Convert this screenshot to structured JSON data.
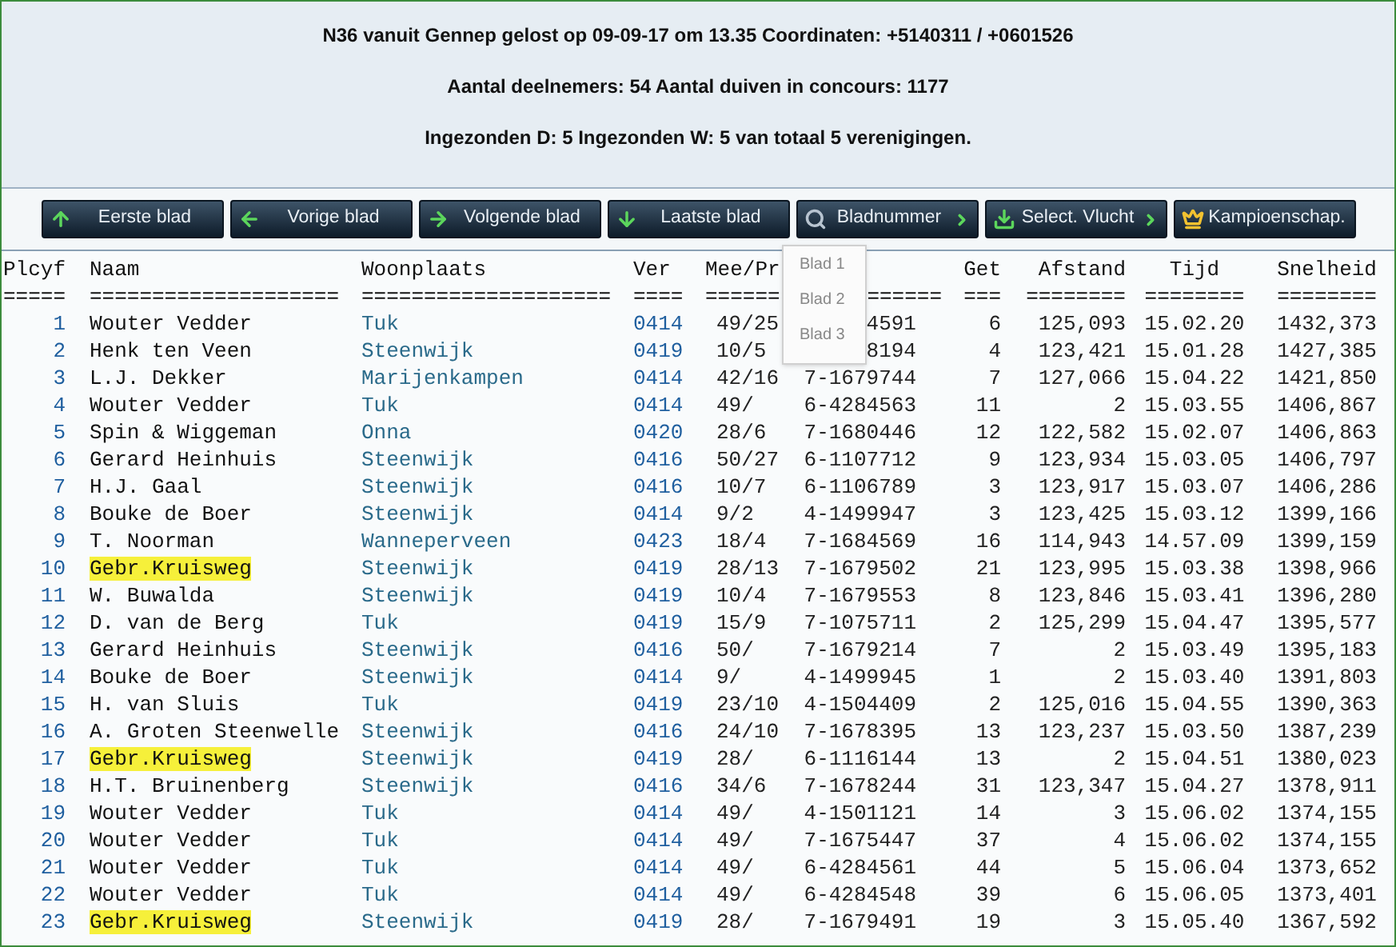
{
  "header": {
    "lines": [
      "N36 vanuit Gennep gelost op 09-09-17 om 13.35 Coordinaten: +5140311 / +0601526",
      "Aantal deelnemers: 54 Aantal duiven in concours: 1177",
      "Ingezonden D: 5 Ingezonden W: 5 van totaal 5 verenigingen."
    ]
  },
  "toolbar": [
    {
      "label": "Eerste blad",
      "submenu": false
    },
    {
      "label": "Vorige blad",
      "submenu": false
    },
    {
      "label": "Volgende blad",
      "submenu": false
    },
    {
      "label": "Laatste blad",
      "submenu": false
    },
    {
      "label": "Bladnummer",
      "submenu": true
    },
    {
      "label": "Select. Vlucht",
      "submenu": true
    },
    {
      "label": "Kampioenschap.",
      "submenu": false
    }
  ],
  "page_menu": {
    "items": [
      "Blad 1",
      "Blad 2",
      "Blad 3"
    ]
  },
  "table": {
    "columns": [
      {
        "label": "Plcyf",
        "underline": "====="
      },
      {
        "label": "Naam",
        "underline": "===================="
      },
      {
        "label": "Woonplaats",
        "underline": "===================="
      },
      {
        "label": "Ver",
        "underline": "===="
      },
      {
        "label": "Mee/Pr",
        "underline": "======"
      },
      {
        "underline": "======"
      },
      {
        "label": "Get",
        "underline": "==="
      },
      {
        "label": "Afstand",
        "underline": "========"
      },
      {
        "label": "Tijd",
        "underline": "========"
      },
      {
        "label": "Snelheid",
        "underline": "========"
      }
    ],
    "rows": [
      {
        "highlighted": false,
        "cells": [
          "1",
          "Wouter Vedder",
          "Tuk",
          "0414",
          "49/25",
          "4591",
          "6",
          "125,093",
          "15.02.20",
          "1432,373"
        ]
      },
      {
        "highlighted": false,
        "cells": [
          "2",
          "Henk ten Veen",
          "Steenwijk",
          "0419",
          "10/5",
          "8194",
          "4",
          "123,421",
          "15.01.28",
          "1427,385"
        ]
      },
      {
        "highlighted": false,
        "cells": [
          "3",
          "L.J. Dekker",
          "Marijenkampen",
          "0414",
          "42/16",
          "7-1679744",
          "7",
          "127,066",
          "15.04.22",
          "1421,850"
        ]
      },
      {
        "highlighted": false,
        "cells": [
          "4",
          "Wouter Vedder",
          "Tuk",
          "0414",
          "49/",
          "6-4284563",
          "11",
          "2",
          "15.03.55",
          "1406,867"
        ]
      },
      {
        "highlighted": false,
        "cells": [
          "5",
          "Spin & Wiggeman",
          "Onna",
          "0420",
          "28/6",
          "7-1680446",
          "12",
          "122,582",
          "15.02.07",
          "1406,863"
        ]
      },
      {
        "highlighted": false,
        "cells": [
          "6",
          "Gerard Heinhuis",
          "Steenwijk",
          "0416",
          "50/27",
          "6-1107712",
          "9",
          "123,934",
          "15.03.05",
          "1406,797"
        ]
      },
      {
        "highlighted": false,
        "cells": [
          "7",
          "H.J. Gaal",
          "Steenwijk",
          "0416",
          "10/7",
          "6-1106789",
          "3",
          "123,917",
          "15.03.07",
          "1406,286"
        ]
      },
      {
        "highlighted": false,
        "cells": [
          "8",
          "Bouke de Boer",
          "Steenwijk",
          "0414",
          "9/2",
          "4-1499947",
          "3",
          "123,425",
          "15.03.12",
          "1399,166"
        ]
      },
      {
        "highlighted": false,
        "cells": [
          "9",
          "T. Noorman",
          "Wanneperveen",
          "0423",
          "18/4",
          "7-1684569",
          "16",
          "114,943",
          "14.57.09",
          "1399,159"
        ]
      },
      {
        "highlighted": true,
        "cells": [
          "10",
          "Gebr.Kruisweg",
          "Steenwijk",
          "0419",
          "28/13",
          "7-1679502",
          "21",
          "123,995",
          "15.03.38",
          "1398,966"
        ]
      },
      {
        "highlighted": false,
        "cells": [
          "11",
          "W. Buwalda",
          "Steenwijk",
          "0419",
          "10/4",
          "7-1679553",
          "8",
          "123,846",
          "15.03.41",
          "1396,280"
        ]
      },
      {
        "highlighted": false,
        "cells": [
          "12",
          "D. van de Berg",
          "Tuk",
          "0419",
          "15/9",
          "7-1075711",
          "2",
          "125,299",
          "15.04.47",
          "1395,577"
        ]
      },
      {
        "highlighted": false,
        "cells": [
          "13",
          "Gerard Heinhuis",
          "Steenwijk",
          "0416",
          "50/",
          "7-1679214",
          "7",
          "2",
          "15.03.49",
          "1395,183"
        ]
      },
      {
        "highlighted": false,
        "cells": [
          "14",
          "Bouke de Boer",
          "Steenwijk",
          "0414",
          "9/",
          "4-1499945",
          "1",
          "2",
          "15.03.40",
          "1391,803"
        ]
      },
      {
        "highlighted": false,
        "cells": [
          "15",
          "H. van Sluis",
          "Tuk",
          "0419",
          "23/10",
          "4-1504409",
          "2",
          "125,016",
          "15.04.55",
          "1390,363"
        ]
      },
      {
        "highlighted": false,
        "cells": [
          "16",
          "A. Groten Steenwelle",
          "Steenwijk",
          "0416",
          "24/10",
          "7-1678395",
          "13",
          "123,237",
          "15.03.50",
          "1387,239"
        ]
      },
      {
        "highlighted": true,
        "cells": [
          "17",
          "Gebr.Kruisweg",
          "Steenwijk",
          "0419",
          "28/",
          "6-1116144",
          "13",
          "2",
          "15.04.51",
          "1380,023"
        ]
      },
      {
        "highlighted": false,
        "cells": [
          "18",
          "H.T. Bruinenberg",
          "Steenwijk",
          "0416",
          "34/6",
          "7-1678244",
          "31",
          "123,347",
          "15.04.27",
          "1378,911"
        ]
      },
      {
        "highlighted": false,
        "cells": [
          "19",
          "Wouter Vedder",
          "Tuk",
          "0414",
          "49/",
          "4-1501121",
          "14",
          "3",
          "15.06.02",
          "1374,155"
        ]
      },
      {
        "highlighted": false,
        "cells": [
          "20",
          "Wouter Vedder",
          "Tuk",
          "0414",
          "49/",
          "7-1675447",
          "37",
          "4",
          "15.06.02",
          "1374,155"
        ]
      },
      {
        "highlighted": false,
        "cells": [
          "21",
          "Wouter Vedder",
          "Tuk",
          "0414",
          "49/",
          "6-4284561",
          "44",
          "5",
          "15.06.04",
          "1373,652"
        ]
      },
      {
        "highlighted": false,
        "cells": [
          "22",
          "Wouter Vedder",
          "Tuk",
          "0414",
          "49/",
          "6-4284548",
          "39",
          "6",
          "15.06.05",
          "1373,401"
        ]
      },
      {
        "highlighted": true,
        "cells": [
          "23",
          "Gebr.Kruisweg",
          "Steenwijk",
          "0419",
          "28/",
          "7-1679491",
          "19",
          "3",
          "15.05.40",
          "1367,592"
        ]
      }
    ]
  }
}
